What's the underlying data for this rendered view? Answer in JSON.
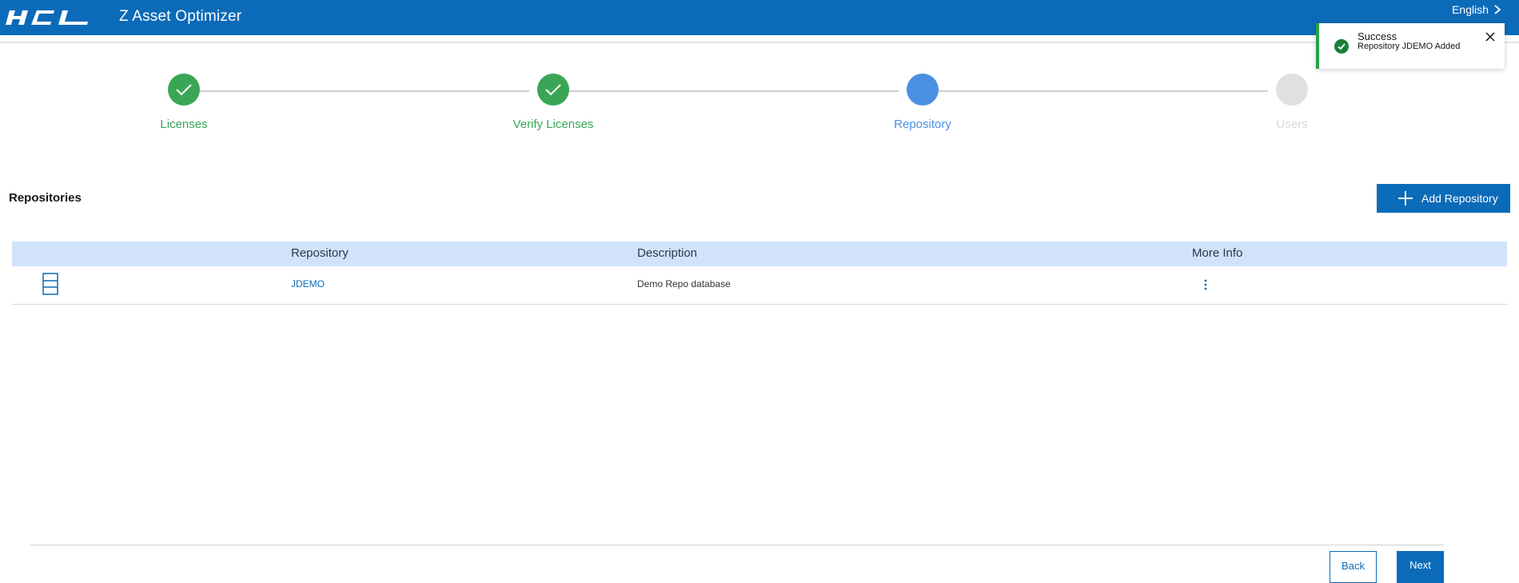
{
  "header": {
    "logo_text": "HCL",
    "app_title": "Z Asset Optimizer",
    "language": "English",
    "icons": {
      "language_chevron": "chevron-right-icon"
    }
  },
  "toast": {
    "title": "Success",
    "message": "Repository JDEMO Added",
    "icons": {
      "status": "check-circle-icon",
      "close": "close-icon"
    },
    "color": "#24a148"
  },
  "stepper": {
    "steps": [
      {
        "label": "Licenses",
        "state": "done"
      },
      {
        "label": "Verify Licenses",
        "state": "done"
      },
      {
        "label": "Repository",
        "state": "current"
      },
      {
        "label": "Users",
        "state": "todo"
      }
    ],
    "colors": {
      "done": "#3aa655",
      "current": "#4a90e2",
      "todo": "#e0e0e0"
    }
  },
  "section": {
    "title": "Repositories",
    "add_button": "Add Repository",
    "add_icon": "plus-icon"
  },
  "table": {
    "columns": [
      "Repository",
      "Description",
      "More Info"
    ],
    "rows": [
      {
        "icon": "database-icon",
        "repository": "JDEMO",
        "description": "Demo Repo database",
        "more_icon": "kebab-menu-icon"
      }
    ]
  },
  "footer": {
    "back": "Back",
    "next": "Next"
  },
  "colors": {
    "brand": "#0b6bb8",
    "header_row": "#d0e3fa"
  }
}
